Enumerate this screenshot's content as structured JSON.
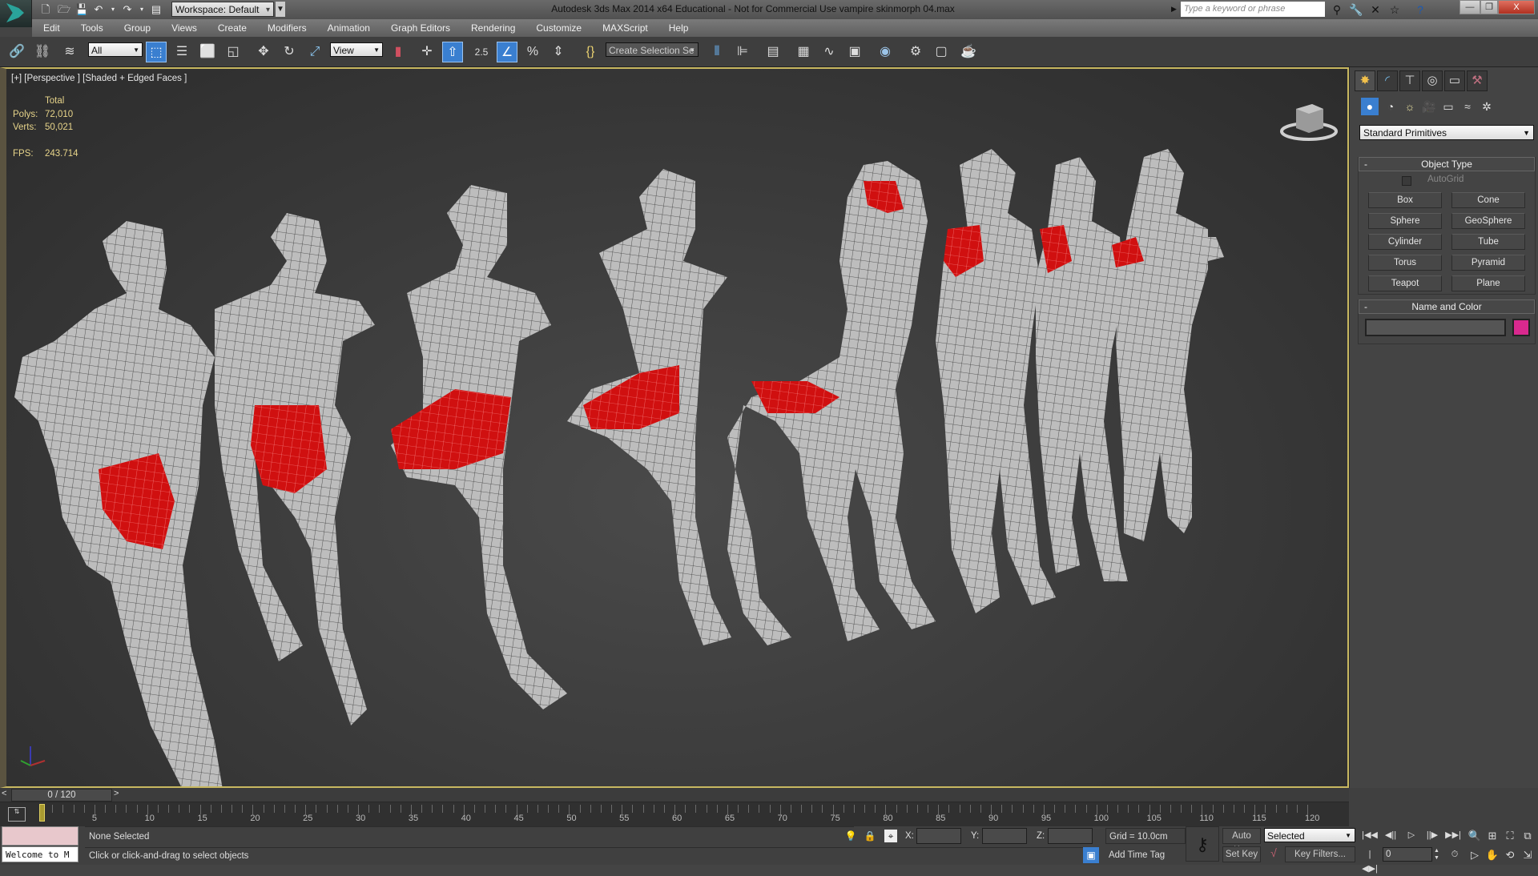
{
  "titlebar": {
    "title": "Autodesk 3ds Max  2014 x64   Educational - Not for Commercial Use    vampire skinmorph 04.max",
    "workspace": "Workspace: Default",
    "search_placeholder": "Type a keyword or phrase",
    "window_buttons": {
      "minimize": "—",
      "restore": "❐",
      "close": "X"
    }
  },
  "menu": [
    "Edit",
    "Tools",
    "Group",
    "Views",
    "Create",
    "Modifiers",
    "Animation",
    "Graph Editors",
    "Rendering",
    "Customize",
    "MAXScript",
    "Help"
  ],
  "toolbar": {
    "selection_filter": "All",
    "ref_coord": "View",
    "snap_value": "2.5",
    "named_selection": "Create Selection Se"
  },
  "viewport": {
    "label": "[+] [Perspective ] [Shaded + Edged Faces ]",
    "stats": {
      "header": "Total",
      "polys_label": "Polys:",
      "polys": "72,010",
      "verts_label": "Verts:",
      "verts": "50,021",
      "fps_label": "FPS:",
      "fps": "243.714"
    },
    "highlight_color": "#d01010",
    "mesh_color": "#b9b9b9"
  },
  "command_panel": {
    "category": "Standard Primitives",
    "object_type_title": "Object Type",
    "autogrid": "AutoGrid",
    "primitives": [
      "Box",
      "Cone",
      "Sphere",
      "GeoSphere",
      "Cylinder",
      "Tube",
      "Torus",
      "Pyramid",
      "Teapot",
      "Plane"
    ],
    "name_color_title": "Name and Color",
    "name_value": "",
    "object_color": "#d9298e"
  },
  "timeline": {
    "slider_label": "0 / 120",
    "current_frame": 0,
    "start": 0,
    "end": 120,
    "labels": [
      "0",
      "5",
      "10",
      "15",
      "20",
      "25",
      "30",
      "35",
      "40",
      "45",
      "50",
      "55",
      "60",
      "65",
      "70",
      "75",
      "80",
      "85",
      "90",
      "95",
      "100",
      "105",
      "110",
      "115",
      "120"
    ]
  },
  "status": {
    "listener_text": "Welcome to M",
    "selection": "None Selected",
    "prompt": "Click or click-and-drag to select objects",
    "x_label": "X:",
    "y_label": "Y:",
    "z_label": "Z:",
    "x": "",
    "y": "",
    "z": "",
    "grid": "Grid = 10.0cm",
    "add_time_tag": "Add Time Tag",
    "auto_key": "Auto Key",
    "set_key": "Set Key",
    "key_mode": "Selected",
    "key_filters": "Key Filters...",
    "frame": "0"
  }
}
